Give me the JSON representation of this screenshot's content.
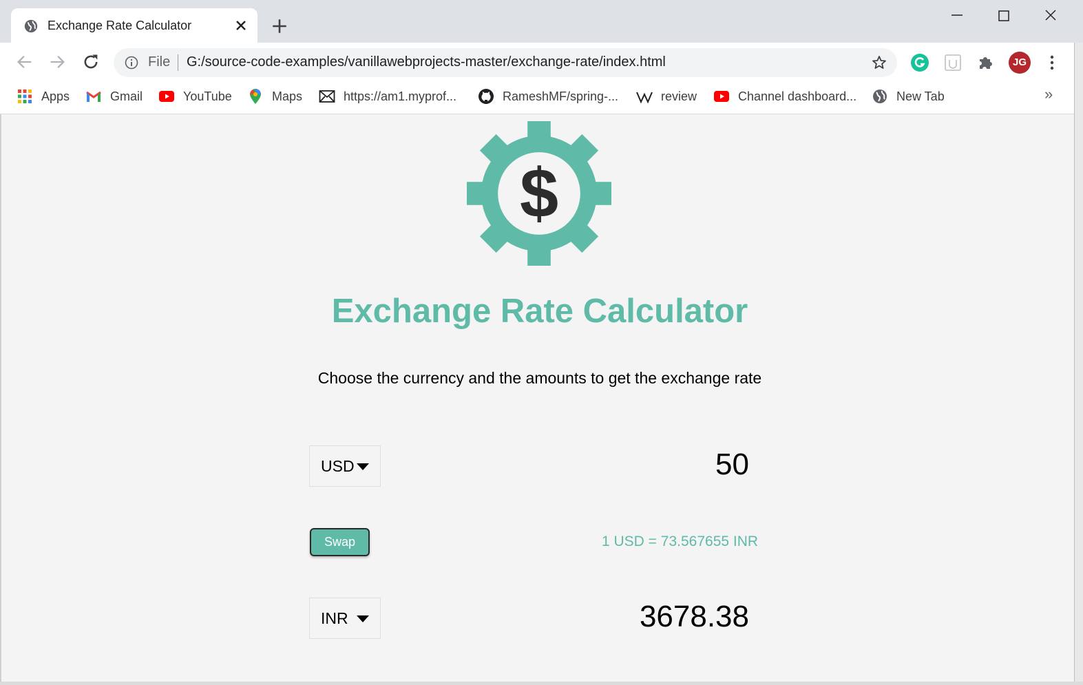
{
  "browser": {
    "tab": {
      "title": "Exchange Rate Calculator"
    },
    "address": {
      "scheme": "File",
      "url": "G:/source-code-examples/vanillawebprojects-master/exchange-rate/index.html"
    },
    "profile_initials": "JG",
    "bookmarks": [
      {
        "label": "Apps",
        "icon": "apps-grid-icon"
      },
      {
        "label": "Gmail",
        "icon": "gmail-icon"
      },
      {
        "label": "YouTube",
        "icon": "youtube-icon"
      },
      {
        "label": "Maps",
        "icon": "maps-pin-icon"
      },
      {
        "label": "https://am1.myprof...",
        "icon": "mail-envelope-icon"
      },
      {
        "label": "RameshMF/spring-...",
        "icon": "github-icon"
      },
      {
        "label": "review",
        "icon": "wikipedia-icon"
      },
      {
        "label": "Channel dashboard...",
        "icon": "youtube-icon"
      },
      {
        "label": "New Tab",
        "icon": "globe-icon"
      }
    ],
    "bookmarks_overflow": "»"
  },
  "app": {
    "title": "Exchange Rate Calculator",
    "subtitle": "Choose the currency and the amounts to get the exchange rate",
    "currency_one": {
      "code": "USD",
      "amount": "50"
    },
    "swap_label": "Swap",
    "rate": "1 USD = 73.567655 INR",
    "currency_two": {
      "code": "INR",
      "amount": "3678.38"
    }
  },
  "colors": {
    "accent": "#5fbaa7",
    "page_background": "#f4f4f4",
    "tabstrip": "#dee1e6",
    "logo_dark": "#2c2c2c"
  }
}
